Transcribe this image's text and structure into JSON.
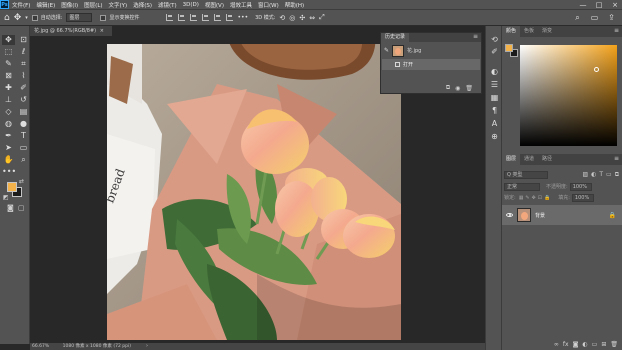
{
  "menubar": {
    "logo": "Ps",
    "items": [
      "文件(F)",
      "编辑(E)",
      "图像(I)",
      "图层(L)",
      "文字(Y)",
      "选择(S)",
      "滤镜(T)",
      "3D(D)",
      "视图(V)",
      "增效工具",
      "窗口(W)",
      "帮助(H)"
    ],
    "window_controls": [
      "—",
      "□",
      "×"
    ]
  },
  "options_bar": {
    "auto_select_label": "自动选择:",
    "auto_select_value": "图层",
    "show_transform_label": "显示变换控件",
    "mode_label": "3D 模式:"
  },
  "document": {
    "tab_title": "花.jpg @ 66.7%(RGB/8#)",
    "tab_close": "×"
  },
  "statusbar": {
    "zoom": "66.67%",
    "info": "1080 像素 x 1080 像素 (72 ppi)",
    "caret": "›"
  },
  "history": {
    "tab_label": "历史记录",
    "menu_icon": "≡",
    "snapshot_name": "花.jpg",
    "steps": [
      "打开"
    ]
  },
  "color_panel": {
    "tabs": [
      "颜色",
      "色板",
      "渐变"
    ],
    "menu_icon": "≡",
    "foreground": "#f3b34a",
    "background": "#1b1b1b",
    "field_hue": "#f4a21a"
  },
  "layers_panel": {
    "tabs": [
      "图层",
      "通道",
      "路径"
    ],
    "menu_icon": "≡",
    "filter_kind": "Q 类型",
    "blend_mode": "正常",
    "opacity_label": "不透明度:",
    "opacity_value": "100%",
    "lock_label": "锁定:",
    "fill_label": "填充:",
    "fill_value": "100%",
    "layer_name": "背景"
  },
  "tools": [
    "move-tool",
    "artboard-tool",
    "marquee-tool",
    "lasso-tool",
    "quick-select-tool",
    "crop-tool",
    "frame-tool",
    "eyedropper-tool",
    "healing-tool",
    "brush-tool",
    "stamp-tool",
    "history-brush-tool",
    "eraser-tool",
    "gradient-tool",
    "blur-tool",
    "dodge-tool",
    "pen-tool",
    "type-tool",
    "path-select-tool",
    "shape-tool",
    "hand-tool",
    "zoom-tool"
  ]
}
